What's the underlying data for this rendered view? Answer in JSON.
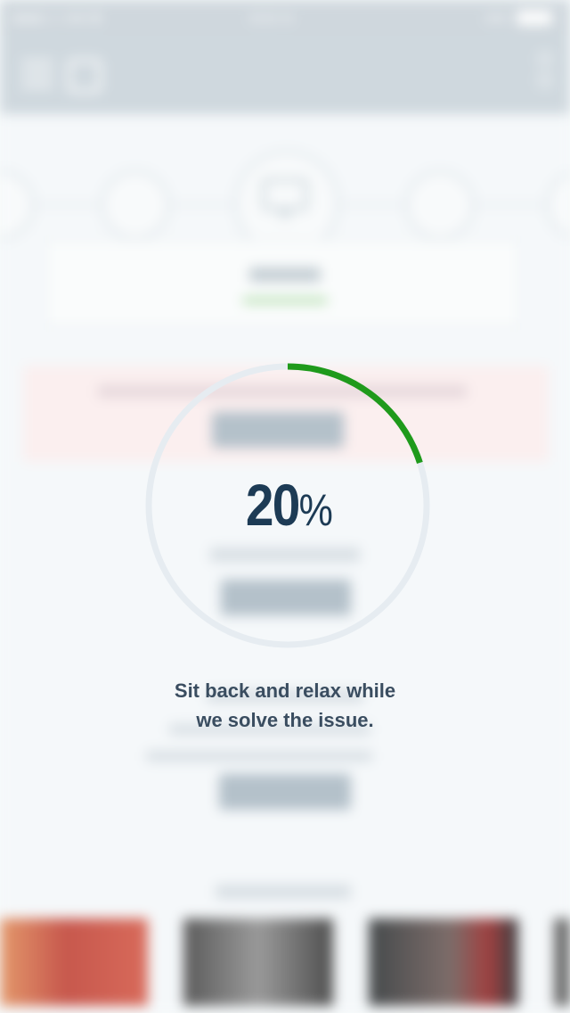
{
  "overlay": {
    "progress_value": "20",
    "progress_unit": "%",
    "progress_fraction": 0.2,
    "message_line1": "Sit back and relax while",
    "message_line2": "we solve the issue.",
    "colors": {
      "ring_fill": "#1f9a1b",
      "ring_track": "#e6ecf1",
      "percent_text": "#1d3b55",
      "message_text": "#3a4d60"
    }
  },
  "background": {
    "status_bar_color": "#cfd7dd",
    "header_color": "#cfd8de",
    "icons": [
      "hamburger-icon",
      "logo-icon",
      "kebab-icon",
      "monitor-icon"
    ]
  }
}
